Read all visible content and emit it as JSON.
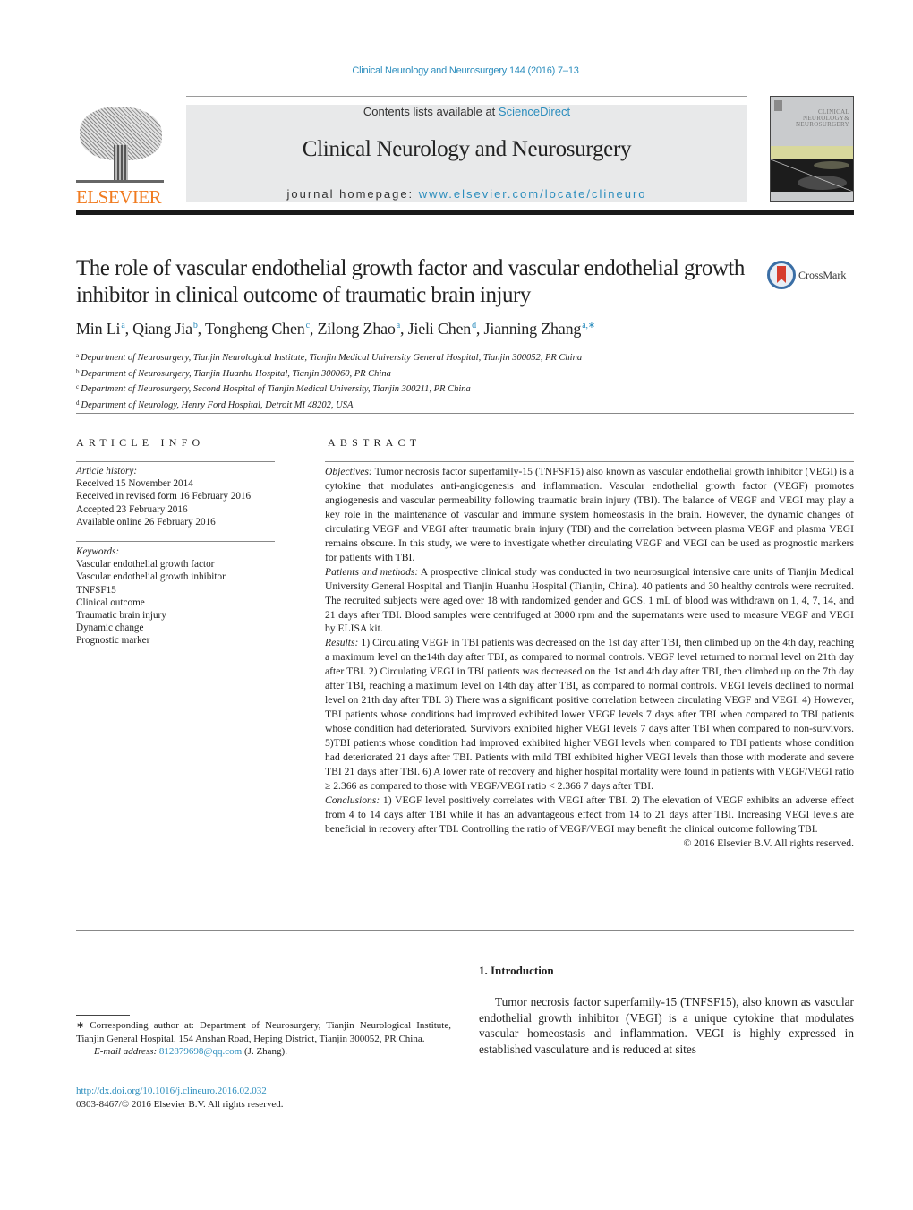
{
  "header": {
    "journal_ref": "Clinical Neurology and Neurosurgery 144 (2016) 7–13",
    "publisher_logo_text": "ELSEVIER",
    "contents_prefix": "Contents lists available at ",
    "contents_link": "ScienceDirect",
    "journal_title": "Clinical Neurology and Neurosurgery",
    "homepage_prefix": "journal homepage: ",
    "homepage_link": "www.elsevier.com/locate/clineuro",
    "cover_title_lines": [
      "CLINICAL",
      "NEUROLOGY&",
      "NEUROSURGERY"
    ]
  },
  "article": {
    "title": "The role of vascular endothelial growth factor and vascular endothelial growth inhibitor in clinical outcome of traumatic brain injury",
    "crossmark_label": "CrossMark",
    "authors": [
      {
        "name": "Min Li",
        "sup": "a",
        "sep": ", "
      },
      {
        "name": "Qiang Jia",
        "sup": "b",
        "sep": ", "
      },
      {
        "name": "Tongheng Chen",
        "sup": "c",
        "sep": ", "
      },
      {
        "name": "Zilong Zhao",
        "sup": "a",
        "sep": ", "
      },
      {
        "name": "Jieli Chen",
        "sup": "d",
        "sep": ", "
      },
      {
        "name": "Jianning Zhang",
        "sup": "a,∗",
        "sep": ""
      }
    ],
    "affiliations": [
      {
        "sup": "a",
        "text": "Department of Neurosurgery, Tianjin Neurological Institute, Tianjin Medical University General Hospital, Tianjin 300052, PR China"
      },
      {
        "sup": "b",
        "text": "Department of Neurosurgery, Tianjin Huanhu Hospital, Tianjin 300060, PR China"
      },
      {
        "sup": "c",
        "text": "Department of Neurosurgery, Second Hospital of Tianjin Medical University, Tianjin 300211, PR China"
      },
      {
        "sup": "d",
        "text": "Department of Neurology, Henry Ford Hospital, Detroit MI 48202, USA"
      }
    ]
  },
  "article_info": {
    "heading": "ARTICLE INFO",
    "history_label": "Article history:",
    "history": [
      "Received 15 November 2014",
      "Received in revised form 16 February 2016",
      "Accepted 23 February 2016",
      "Available online 26 February 2016"
    ],
    "keywords_label": "Keywords:",
    "keywords": [
      "Vascular endothelial growth factor",
      "Vascular endothelial growth inhibitor",
      "TNFSF15",
      "Clinical outcome",
      "Traumatic brain injury",
      "Dynamic change",
      "Prognostic marker"
    ]
  },
  "abstract": {
    "heading": "ABSTRACT",
    "sections": [
      {
        "label": "Objectives:",
        "text": " Tumor necrosis factor superfamily-15 (TNFSF15) also known as vascular endothelial growth inhibitor (VEGI) is a cytokine that modulates anti-angiogenesis and inflammation. Vascular endothelial growth factor (VEGF) promotes angiogenesis and vascular permeability following traumatic brain injury (TBI). The balance of VEGF and VEGI may play a key role in the maintenance of vascular and immune system homeostasis in the brain. However, the dynamic changes of circulating VEGF and VEGI after traumatic brain injury (TBI) and the correlation between plasma VEGF and plasma VEGI remains obscure. In this study, we were to investigate whether circulating VEGF and VEGI can be used as prognostic markers for patients with TBI."
      },
      {
        "label": "Patients and methods:",
        "text": " A prospective clinical study was conducted in two neurosurgical intensive care units of Tianjin Medical University General Hospital and Tianjin Huanhu Hospital (Tianjin, China). 40 patients and 30 healthy controls were recruited. The recruited subjects were aged over 18 with randomized gender and GCS. 1 mL of blood was withdrawn on 1, 4, 7, 14, and 21 days after TBI. Blood samples were centrifuged at 3000 rpm and the supernatants were used to measure VEGF and VEGI by ELISA kit."
      },
      {
        "label": "Results:",
        "text": " 1) Circulating VEGF in TBI patients was decreased on the 1st day after TBI, then climbed up on the 4th day, reaching a maximum level on the14th day after TBI, as compared to normal controls. VEGF level returned to normal level on 21th day after TBI. 2) Circulating VEGI in TBI patients was decreased on the 1st and 4th day after TBI, then climbed up on the 7th day after TBI, reaching a maximum level on 14th day after TBI, as compared to normal controls. VEGI levels declined to normal level on 21th day after TBI. 3) There was a significant positive correlation between circulating VEGF and VEGI. 4) However, TBI patients whose conditions had improved exhibited lower VEGF levels 7 days after TBI when compared to TBI patients whose condition had deteriorated. Survivors exhibited higher VEGI levels 7 days after TBI when compared to non-survivors. 5)TBI patients whose condition had improved exhibited higher VEGI levels when compared to TBI patients whose condition had deteriorated 21 days after TBI. Patients with mild TBI exhibited higher VEGI levels than those with moderate and severe TBI 21 days after TBI. 6) A lower rate of recovery and higher hospital mortality were found in patients with VEGF/VEGI ratio ≥ 2.366 as compared to those with VEGF/VEGI ratio < 2.366 7 days after TBI."
      },
      {
        "label": "Conclusions:",
        "text": " 1) VEGF level positively correlates with VEGI after TBI. 2) The elevation of VEGF exhibits an adverse effect from 4 to 14 days after TBI while it has an advantageous effect from 14 to 21 days after TBI. Increasing VEGI levels are beneficial in recovery after TBI. Controlling the ratio of VEGF/VEGI may benefit the clinical outcome following TBI."
      }
    ],
    "copyright": "© 2016 Elsevier B.V. All rights reserved."
  },
  "introduction": {
    "heading": "1.  Introduction",
    "text": "Tumor necrosis factor superfamily-15 (TNFSF15), also known as vascular endothelial growth inhibitor (VEGI) is a unique cytokine that modulates vascular homeostasis and inflammation. VEGI is highly expressed in established vasculature and is reduced at sites"
  },
  "footnote": {
    "corresponding": "∗  Corresponding author at: Department of Neurosurgery, Tianjin Neurological Institute, Tianjin General Hospital, 154 Anshan Road, Heping District, Tianjin 300052, PR China.",
    "email_label": "E-mail address:",
    "email": "812879698@qq.com",
    "email_suffix": " (J. Zhang).",
    "doi": "http://dx.doi.org/10.1016/j.clineuro.2016.02.032",
    "issn_rights": "0303-8467/© 2016 Elsevier B.V. All rights reserved."
  },
  "colors": {
    "link": "#2b8dbd",
    "elsevier_orange": "#f07b20",
    "banner_bg": "#e8e9ea",
    "crossmark_red": "#d63d2e",
    "crossmark_blue": "#3a6ea5"
  }
}
